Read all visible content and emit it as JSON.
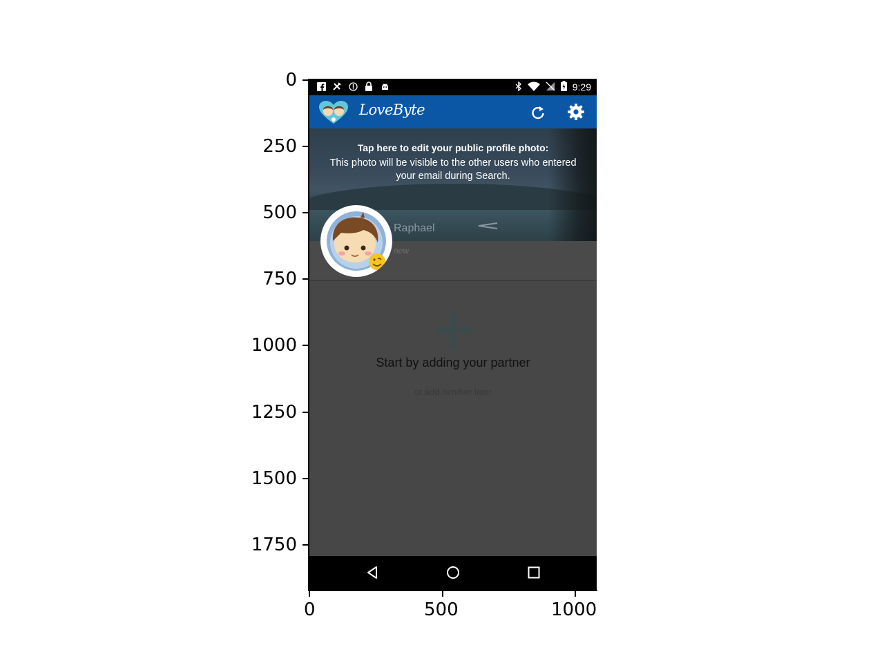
{
  "axes": {
    "y_ticks": [
      "0",
      "250",
      "500",
      "750",
      "1000",
      "1250",
      "1500",
      "1750"
    ],
    "x_ticks": [
      "0",
      "500",
      "1000"
    ]
  },
  "status_bar": {
    "time": "9:29",
    "left_icons": [
      "facebook-icon",
      "tools-icon",
      "info-icon",
      "lock-icon",
      "android-icon"
    ],
    "right_icons": [
      "bluetooth-icon",
      "wifi-icon",
      "no-sim-icon",
      "battery-icon"
    ]
  },
  "app_bar": {
    "title": "LoveByte",
    "color": "#0c57a5",
    "actions": [
      "refresh-icon",
      "settings-icon"
    ]
  },
  "profile": {
    "tip_title": "Tap here to edit your public profile photo:",
    "tip_body": "This photo will be visible to the other users who entered your email during Search.",
    "name": "Raphael",
    "status": "new"
  },
  "empty_state": {
    "title": "Start by adding your partner",
    "subtitle": "or add him/her later"
  },
  "nav_bar": {
    "buttons": [
      "back-icon",
      "home-icon",
      "recents-icon"
    ]
  }
}
